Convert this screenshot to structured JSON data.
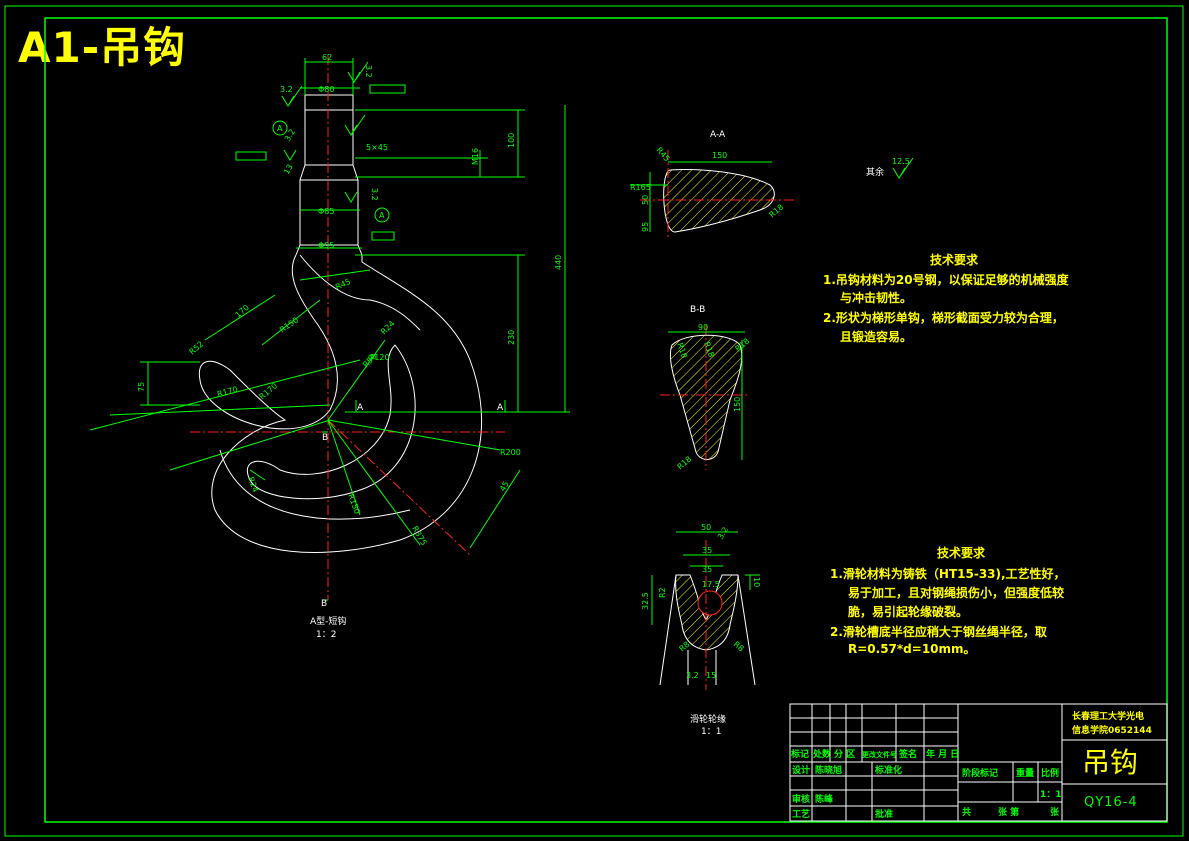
{
  "title": "A1-吊钩",
  "colors": {
    "background": "#000000",
    "line": "#00ff00",
    "outline": "#ffffff",
    "center": "#ff2020",
    "text": "#ffff00"
  },
  "hook_view": {
    "label": "A型-短钩",
    "scale": "1：2",
    "section_marks": [
      "A",
      "A",
      "B",
      "B"
    ],
    "callout": "A",
    "dims": [
      "62",
      "3.2",
      "3.2",
      "Φ80",
      "100",
      "5×45",
      "3.2",
      "Φ85",
      "Φ95",
      "440",
      "230",
      "R45",
      "R150",
      "R24",
      "R50",
      "R52",
      "170",
      "75",
      "R170",
      "R170",
      "R24",
      "R150",
      "R200",
      "45",
      "R375",
      "Φ120",
      "M16",
      "3.2",
      "13"
    ]
  },
  "section_aa": {
    "label": "A-A",
    "dims": [
      "150",
      "R45",
      "50",
      "R165",
      "R18",
      "95"
    ]
  },
  "section_bb": {
    "label": "B-B",
    "dims": [
      "90",
      "R18",
      "R18",
      "R18",
      "150",
      "R18"
    ]
  },
  "surface_note": {
    "text": "其余",
    "value": "12.5"
  },
  "tech_req_1": {
    "heading": "技术要求",
    "lines": [
      "1.吊钩材料为20号钢，以保证足够的机械强度",
      "与冲击韧性。",
      "2.形状为梯形单钩，梯形截面受力较为合理，",
      "且锻造容易。"
    ]
  },
  "pulley": {
    "label": "滑轮轮缘",
    "scale": "1：1",
    "dims": [
      "50",
      "3.2",
      "35",
      "35",
      "17.5",
      "10",
      "32.5",
      "R2",
      "R8",
      "R8",
      "3.2",
      "15"
    ]
  },
  "tech_req_2": {
    "heading": "技术要求",
    "lines": [
      "1.滑轮材料为铸铁（HT15-33),工艺性好，",
      "易于加工，且对钢绳损伤小，但强度低较",
      "脆，易引起轮缘破裂。",
      "2.滑轮槽底半径应稍大于钢丝绳半径，取",
      "R=0.57*d=10mm。"
    ]
  },
  "title_block": {
    "school": [
      "长春理工大学光电",
      "信息学院0652144"
    ],
    "drawing_name": "吊钩",
    "drawing_no": "QY16-4",
    "scale": "1：1",
    "header_row": [
      "标记",
      "处数",
      "分 区",
      "更改文件号",
      "签名",
      "年 月 日"
    ],
    "rows": [
      [
        "设计",
        "陈晓旭",
        "标准化"
      ],
      [
        "审核",
        "陈峰"
      ],
      [
        "工艺",
        "批准"
      ]
    ],
    "mid_labels": [
      "阶段标记",
      "重量",
      "比例"
    ],
    "sheet_labels": [
      "共",
      "张 第",
      "张"
    ]
  }
}
